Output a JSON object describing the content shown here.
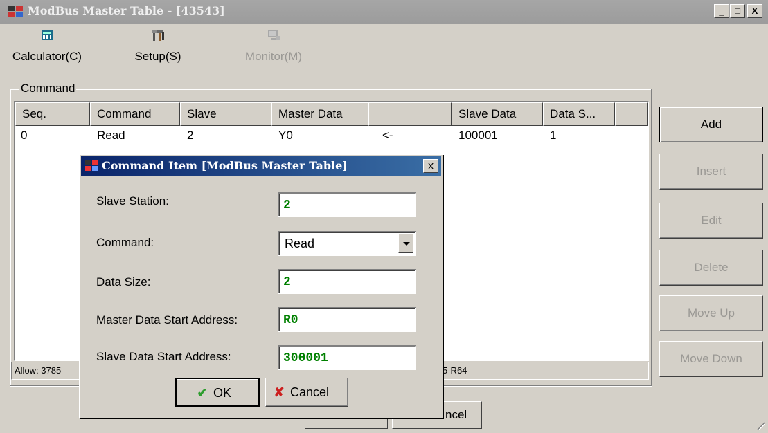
{
  "window": {
    "title": "ModBus Master Table - [43543]",
    "controls": {
      "minimize": "_",
      "maximize": "□",
      "close": "X"
    }
  },
  "toolbar": {
    "calculator": {
      "label": "Calculator(C)",
      "icon": "calculator-icon"
    },
    "setup": {
      "label": "Setup(S)",
      "icon": "tools-icon"
    },
    "monitor": {
      "label": "Monitor(M)",
      "icon": "monitor-icon",
      "disabled": true
    }
  },
  "command_group": {
    "label": "Command"
  },
  "table": {
    "columns": [
      "Seq.",
      "Command",
      "Slave",
      "Master Data",
      "",
      "Slave Data",
      "Data S..."
    ],
    "rows": [
      {
        "seq": "0",
        "command": "Read",
        "slave": "2",
        "master_data": "Y0",
        "direction": "<-",
        "slave_data": "100001",
        "data_size": "1"
      }
    ]
  },
  "status": {
    "left": "Allow: 3785",
    "right": "5-R64"
  },
  "side_buttons": {
    "add": "Add",
    "insert": "Insert",
    "edit": "Edit",
    "delete": "Delete",
    "move_up": "Move Up",
    "move_down": "Move Down"
  },
  "bottom_buttons": {
    "cancel_partial": "ncel"
  },
  "dialog": {
    "title": "Command Item [ModBus Master Table]",
    "close": "X",
    "fields": {
      "slave_station": {
        "label": "Slave Station:",
        "value": "2"
      },
      "command": {
        "label": "Command:",
        "value": "Read"
      },
      "data_size": {
        "label": "Data Size:",
        "value": "2"
      },
      "master_start": {
        "label": "Master Data Start Address:",
        "value": "R0"
      },
      "slave_start": {
        "label": "Slave Data Start Address:",
        "value": "300001"
      }
    },
    "ok": {
      "label": "OK",
      "glyph": "✔"
    },
    "cancel": {
      "label": "Cancel",
      "glyph": "✘"
    }
  },
  "colors": {
    "field_value": "#008000",
    "dialog_title_start": "#0a246a",
    "dialog_title_end": "#3a6ea5",
    "ok_check": "#2e9d2e",
    "cancel_x": "#cc1f1f"
  }
}
